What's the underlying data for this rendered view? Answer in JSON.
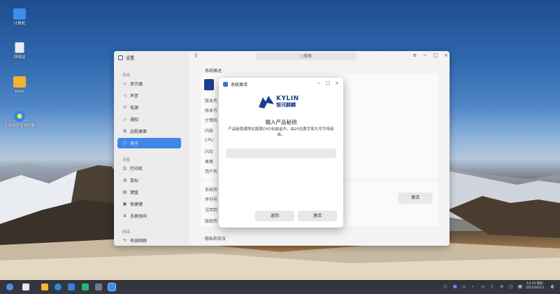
{
  "desktop": {
    "icons": [
      {
        "label": "计算机",
        "icon": "computer-icon"
      },
      {
        "label": "回收站",
        "icon": "trash-icon"
      },
      {
        "label": "kylin",
        "icon": "folder-icon"
      },
      {
        "label": "企业网安全浏览器",
        "icon": "browser-icon"
      }
    ]
  },
  "settings": {
    "title": "设置",
    "search_placeholder": "搜索",
    "groups": {
      "system": "系统",
      "devices": "设备",
      "network": "网络"
    },
    "system_items": [
      "显示器",
      "声音",
      "电源",
      "通知",
      "远程桌面",
      "关于"
    ],
    "device_items": [
      "打印机",
      "鼠标",
      "键盘",
      "快捷键",
      "多屏协同"
    ],
    "network_items": [
      "有线网络"
    ],
    "window_controls": {
      "menu": "≡",
      "minimize": "−",
      "maximize": "□",
      "close": "×"
    }
  },
  "about": {
    "section_title": "系统概述",
    "rows": [
      "版本名",
      "版本号",
      "计算机",
      "内核",
      "CPU",
      "内存",
      "桌面",
      "用户名"
    ],
    "activation_section": "系统状",
    "activation_rows": [
      "序列号",
      "试用到",
      "版权所"
    ],
    "activate_label": "激活",
    "privacy": "隐私和协议"
  },
  "dialog": {
    "title": "系统激活",
    "logo_text": "KYLIN",
    "logo_sub": "银河麒麟",
    "heading": "输入产品秘钥",
    "description": "产品秘钥通常在配套DVD包装盒中，由20位数字和大写字母组成。",
    "input_value": "",
    "back_label": "返回",
    "activate_label": "激活",
    "controls": {
      "minimize": "−",
      "maximize": "□",
      "close": "×"
    }
  },
  "taskbar": {
    "clock_time": "14:10 周四",
    "clock_date": "2022/06/23"
  },
  "colors": {
    "accent": "#3f86e6",
    "brand": "#1b3d8c"
  }
}
